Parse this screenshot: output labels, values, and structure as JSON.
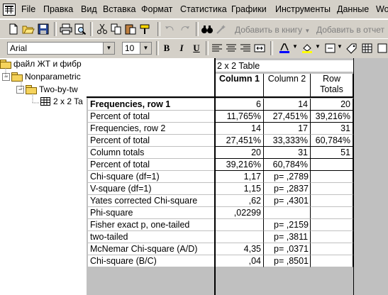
{
  "menu": [
    "File",
    "Правка",
    "Вид",
    "Вставка",
    "Формат",
    "Статистика",
    "Графики",
    "Инструменты",
    "Данные",
    "Wo"
  ],
  "toolbar": {
    "add_to_book": "Добавить в книгу",
    "add_to_report": "Добавить в отчет"
  },
  "format_bar": {
    "font": "Arial",
    "size": "10",
    "bold": "B",
    "italic": "I",
    "underline": "U"
  },
  "tree": {
    "items": [
      "файл ЖТ и фибр",
      "Nonparametric",
      "Two-by-tw",
      "2 x 2 Ta"
    ]
  },
  "table": {
    "title": "2 x 2 Table",
    "headers": [
      "Column 1",
      "Column 2",
      "Row\nTotals"
    ],
    "header_row_totals_line1": "Row",
    "header_row_totals_line2": "Totals",
    "rows": [
      {
        "label": "Frequencies, row 1",
        "c1": "6",
        "c2": "14",
        "c3": "20",
        "bold": true
      },
      {
        "label": "Percent of total",
        "c1": "11,765%",
        "c2": "27,451%",
        "c3": "39,216%"
      },
      {
        "label": "Frequencies, row 2",
        "c1": "14",
        "c2": "17",
        "c3": "31"
      },
      {
        "label": "Percent of total",
        "c1": "27,451%",
        "c2": "33,333%",
        "c3": "60,784%"
      },
      {
        "label": "Column totals",
        "c1": "20",
        "c2": "31",
        "c3": "51"
      },
      {
        "label": "Percent of total",
        "c1": "39,216%",
        "c2": "60,784%",
        "c3": ""
      },
      {
        "label": "Chi-square (df=1)",
        "c1": "1,17",
        "c2": "p= ,2789",
        "c3": ""
      },
      {
        "label": "V-square (df=1)",
        "c1": "1,15",
        "c2": "p= ,2837",
        "c3": ""
      },
      {
        "label": "Yates corrected Chi-square",
        "c1": ",62",
        "c2": "p= ,4301",
        "c3": ""
      },
      {
        "label": "Phi-square",
        "c1": ",02299",
        "c2": "",
        "c3": ""
      },
      {
        "label": "Fisher exact p, one-tailed",
        "c1": "",
        "c2": "p= ,2159",
        "c3": ""
      },
      {
        "label": "two-tailed",
        "c1": "",
        "c2": "p= ,3811",
        "c3": ""
      },
      {
        "label": "McNemar Chi-square (A/D)",
        "c1": "4,35",
        "c2": "p= ,0371",
        "c3": ""
      },
      {
        "label": "Chi-square (B/C)",
        "c1": ",04",
        "c2": "p= ,8501",
        "c3": ""
      }
    ]
  }
}
